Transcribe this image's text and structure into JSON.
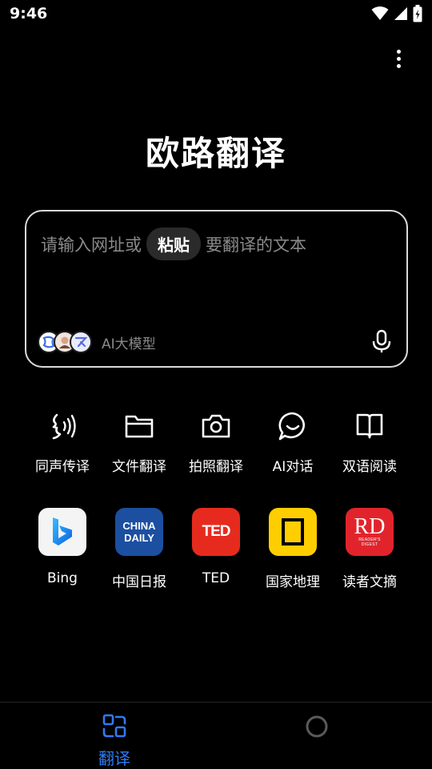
{
  "status_bar": {
    "time": "9:46"
  },
  "app": {
    "title": "欧路翻译"
  },
  "input": {
    "placeholder_prefix": "请输入网址或",
    "paste_label": "粘贴",
    "placeholder_suffix": "要翻译的文本",
    "ai_label": "AI大模型"
  },
  "features": [
    {
      "label": "同声传译",
      "icon": "simultaneous-interpretation-icon"
    },
    {
      "label": "文件翻译",
      "icon": "folder-icon"
    },
    {
      "label": "拍照翻译",
      "icon": "camera-icon"
    },
    {
      "label": "AI对话",
      "icon": "chat-bubble-icon"
    },
    {
      "label": "双语阅读",
      "icon": "book-icon"
    }
  ],
  "sites": [
    {
      "label": "Bing",
      "icon": "bing-logo"
    },
    {
      "label": "中国日报",
      "icon": "china-daily-logo",
      "logo_text_1": "CHINA",
      "logo_text_2": "DAILY"
    },
    {
      "label": "TED",
      "icon": "ted-logo",
      "logo_text": "TED"
    },
    {
      "label": "国家地理",
      "icon": "national-geographic-logo"
    },
    {
      "label": "读者文摘",
      "icon": "readers-digest-logo",
      "logo_text": "RD",
      "logo_sub_1": "READER'S",
      "logo_sub_2": "DIGEST"
    }
  ],
  "bottom_nav": {
    "translate_label": "翻译",
    "active_color": "#2f7bf5"
  }
}
